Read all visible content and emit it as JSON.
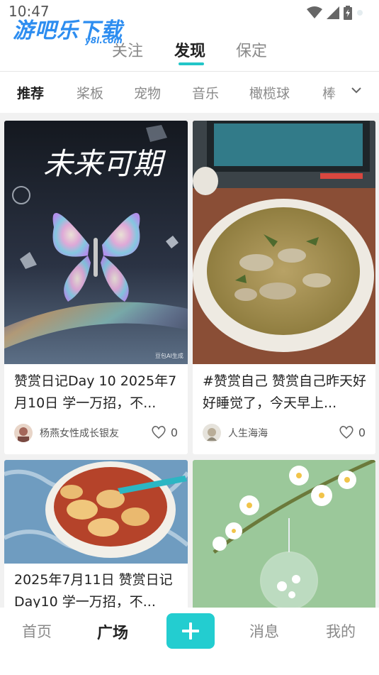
{
  "status": {
    "time": "10:47"
  },
  "watermark": {
    "main": "游吧乐下载",
    "sub": "y8l.com"
  },
  "top_tabs": [
    {
      "label": "关注"
    },
    {
      "label": "发现",
      "active": true
    },
    {
      "label": "保定"
    }
  ],
  "categories": [
    {
      "label": "推荐",
      "active": true
    },
    {
      "label": "桨板"
    },
    {
      "label": "宠物"
    },
    {
      "label": "音乐"
    },
    {
      "label": "橄榄球"
    },
    {
      "label": "棒"
    }
  ],
  "cards": [
    {
      "image_caption": "未来可期",
      "image_watermark": "豆包AI生成",
      "text": "赞赏日记Day 10 2025年7月10日 学一万招，不...",
      "author": "杨燕女性成长银友",
      "likes": "0"
    },
    {
      "text": "#赞赏自己 赞赏自己昨天好好睡觉了，今天早上...",
      "author": "人生海海",
      "likes": "0"
    },
    {
      "text": "2025年7月11日 赞赏日记Day10 学一万招，不..."
    },
    {}
  ],
  "bottom_nav": [
    {
      "label": "首页"
    },
    {
      "label": "广场",
      "active": true
    },
    {
      "label": "消息"
    },
    {
      "label": "我的"
    }
  ],
  "colors": {
    "accent": "#23c6c8"
  },
  "icons": [
    "wifi-icon",
    "signal-icon",
    "battery-icon",
    "chevron-down-icon",
    "heart-outline-icon",
    "plus-icon"
  ]
}
